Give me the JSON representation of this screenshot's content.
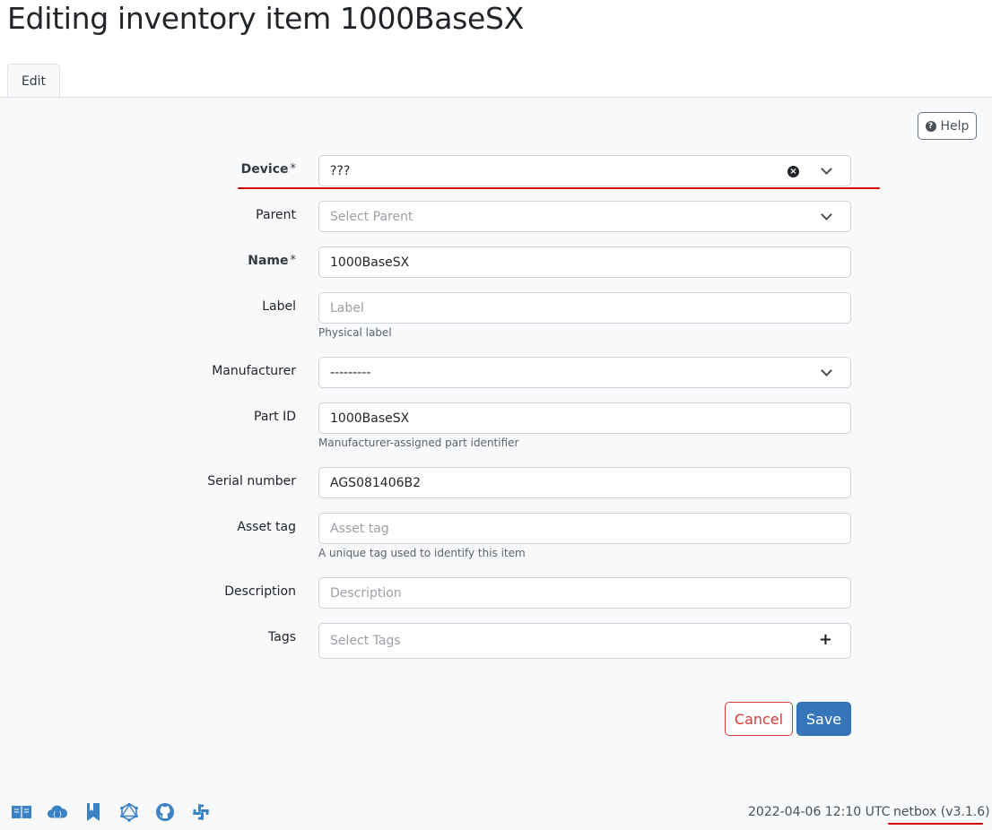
{
  "page": {
    "title": "Editing inventory item 1000BaseSX"
  },
  "tabs": [
    {
      "label": "Edit"
    }
  ],
  "help": {
    "label": "Help"
  },
  "form": {
    "device": {
      "label": "Device",
      "required_mark": "*",
      "value": "???"
    },
    "parent": {
      "label": "Parent",
      "placeholder": "Select Parent"
    },
    "name": {
      "label": "Name",
      "required_mark": "*",
      "value": "1000BaseSX"
    },
    "label_field": {
      "label": "Label",
      "placeholder": "Label",
      "hint": "Physical label"
    },
    "manufacturer": {
      "label": "Manufacturer",
      "value": "---------"
    },
    "part_id": {
      "label": "Part ID",
      "value": "1000BaseSX",
      "hint": "Manufacturer-assigned part identifier"
    },
    "serial": {
      "label": "Serial number",
      "value": "AGS081406B2"
    },
    "asset_tag": {
      "label": "Asset tag",
      "placeholder": "Asset tag",
      "hint": "A unique tag used to identify this item"
    },
    "description": {
      "label": "Description",
      "placeholder": "Description"
    },
    "tags": {
      "label": "Tags",
      "placeholder": "Select Tags"
    }
  },
  "actions": {
    "cancel": "Cancel",
    "save": "Save"
  },
  "footer": {
    "icons": [
      "docs-book-icon",
      "api-cloud-icon",
      "bookmark-icon",
      "graphql-icon",
      "github-icon",
      "slack-icon"
    ],
    "timestamp": "2022-04-06 12:10 UTC",
    "version": "netbox (v3.1.6)"
  },
  "colors": {
    "primary": "#3575b8",
    "danger": "#d63939",
    "annotation": "#d10000"
  }
}
